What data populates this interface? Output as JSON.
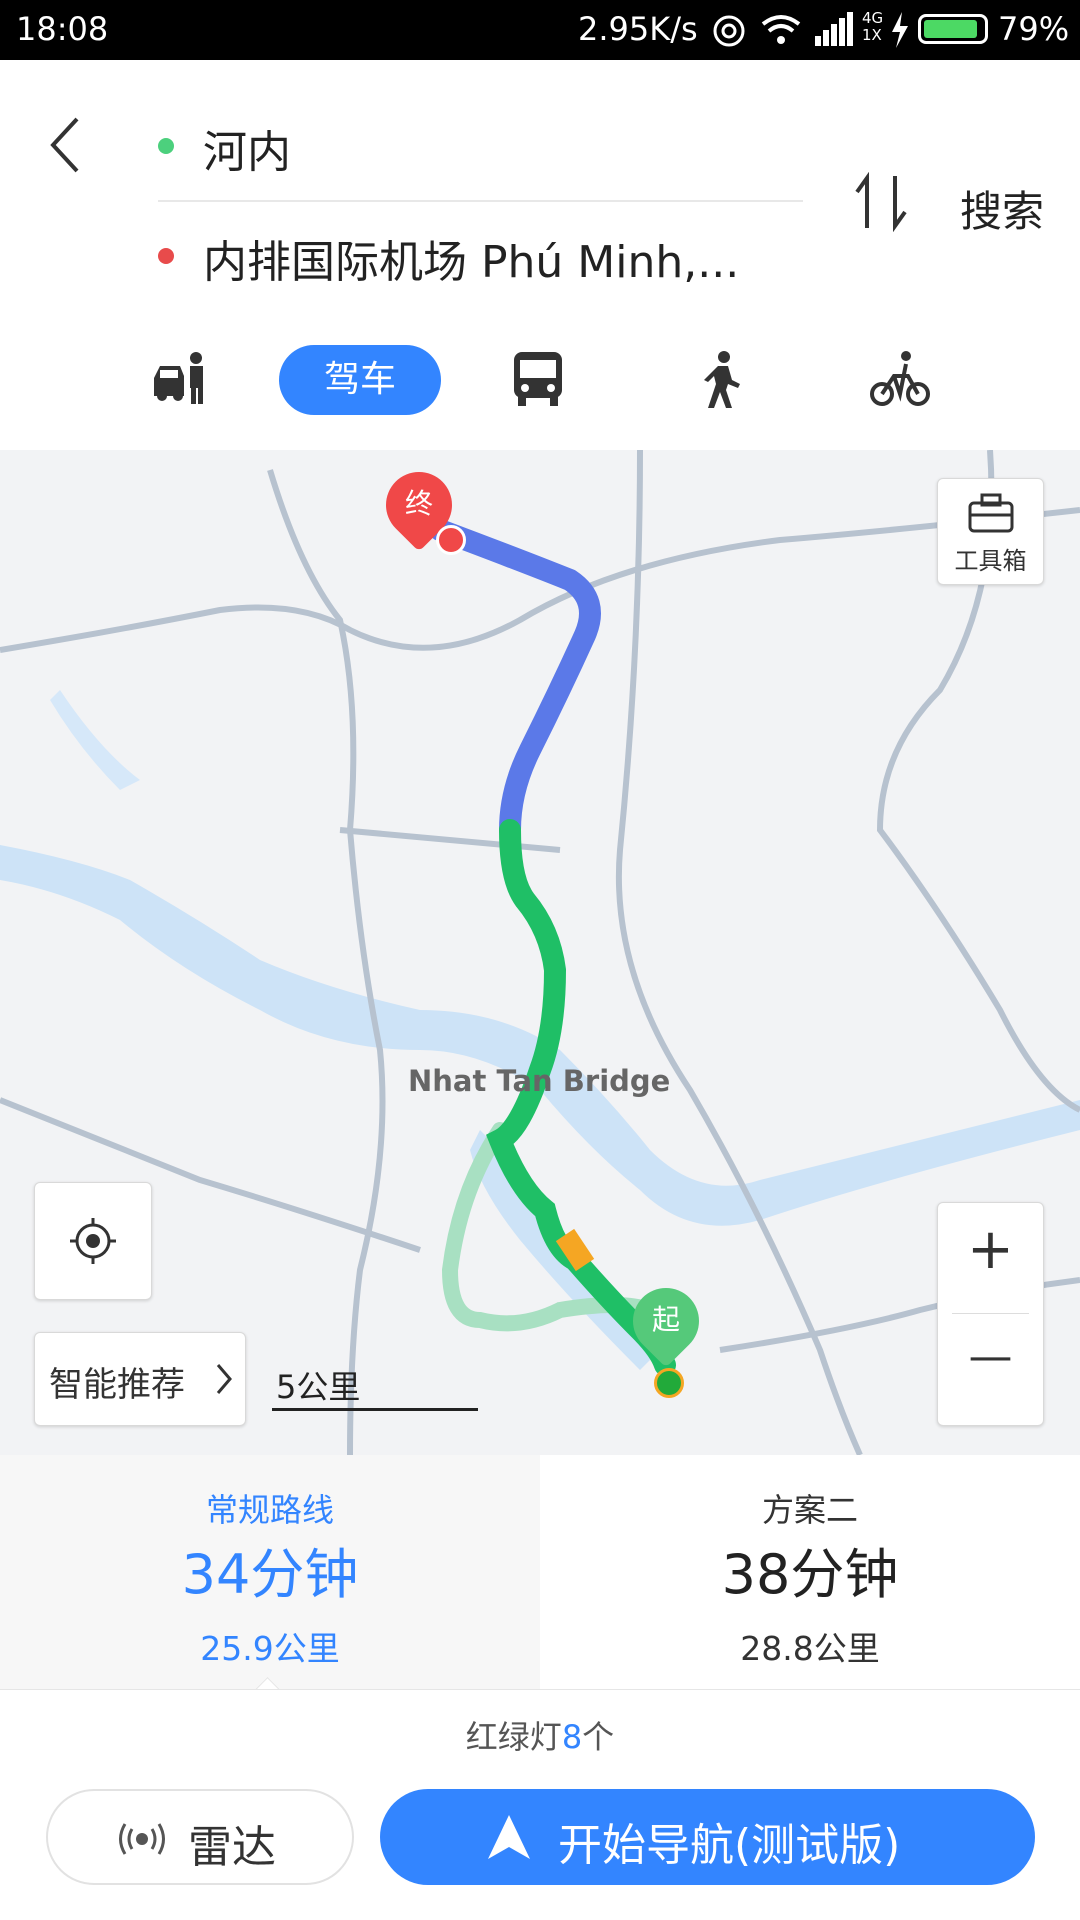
{
  "status_bar": {
    "time": "18:08",
    "speed": "2.95K/s",
    "network": "4G",
    "sim": "1X",
    "battery": "79%"
  },
  "header": {
    "back_icon": "chevron-left-icon",
    "origin": "河内",
    "destination": "内排国际机场 Phú Minh,...",
    "swap_icon": "swap-icon",
    "search_label": "搜索",
    "colors": {
      "origin_dot": "#4cd07d",
      "destination_dot": "#e84b4b",
      "accent": "#3385ff"
    }
  },
  "modes": {
    "taxi_icon": "taxi-icon",
    "drive_label": "驾车",
    "bus_icon": "bus-icon",
    "walk_icon": "walk-icon",
    "bike_icon": "bike-icon"
  },
  "map": {
    "toolbox_label": "工具箱",
    "place_label": "Nhat Tan Bridge",
    "end_marker": "终",
    "start_marker": "起",
    "smart_recommend": "智能推荐",
    "scale": "5公里",
    "zoom_in": "+",
    "zoom_out": "—"
  },
  "routes": [
    {
      "label": "常规路线",
      "time": "34分钟",
      "distance": "25.9公里",
      "selected": true
    },
    {
      "label": "方案二",
      "time": "38分钟",
      "distance": "28.8公里",
      "selected": false
    }
  ],
  "bottom": {
    "lights_prefix": "红绿灯",
    "lights_count": "8",
    "lights_suffix": "个",
    "radar_label": "雷达",
    "nav_label": "开始导航(测试版)"
  }
}
